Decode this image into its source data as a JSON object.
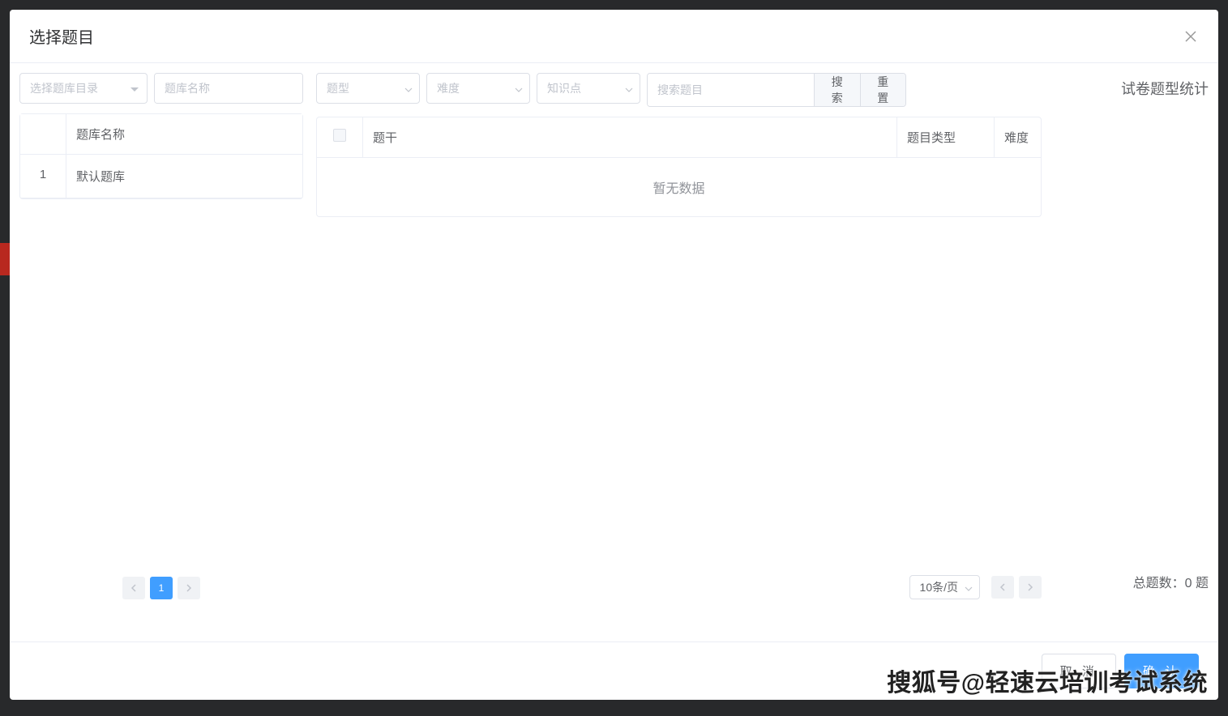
{
  "modal": {
    "title": "选择题目",
    "catalog_placeholder": "选择题库目录",
    "bank_name_placeholder": "题库名称",
    "footer": {
      "cancel": "取 消",
      "confirm": "确 认"
    }
  },
  "filters": {
    "type_placeholder": "题型",
    "difficulty_placeholder": "难度",
    "knowledge_placeholder": "知识点",
    "search_placeholder": "搜索题目",
    "search_btn": "搜索",
    "reset_btn": "重置"
  },
  "bank_table": {
    "header": "题库名称",
    "rows": [
      {
        "num": "1",
        "name": "默认题库"
      }
    ]
  },
  "question_table": {
    "headers": {
      "stem": "题干",
      "type": "题目类型",
      "difficulty": "难度"
    },
    "empty": "暂无数据"
  },
  "pagination": {
    "left_current": "1",
    "page_size": "10条/页"
  },
  "right_panel": {
    "stats_title": "试卷题型统计",
    "total_label": "总题数：",
    "total_value": "0 题"
  },
  "watermark": "搜狐号@轻速云培训考试系统"
}
